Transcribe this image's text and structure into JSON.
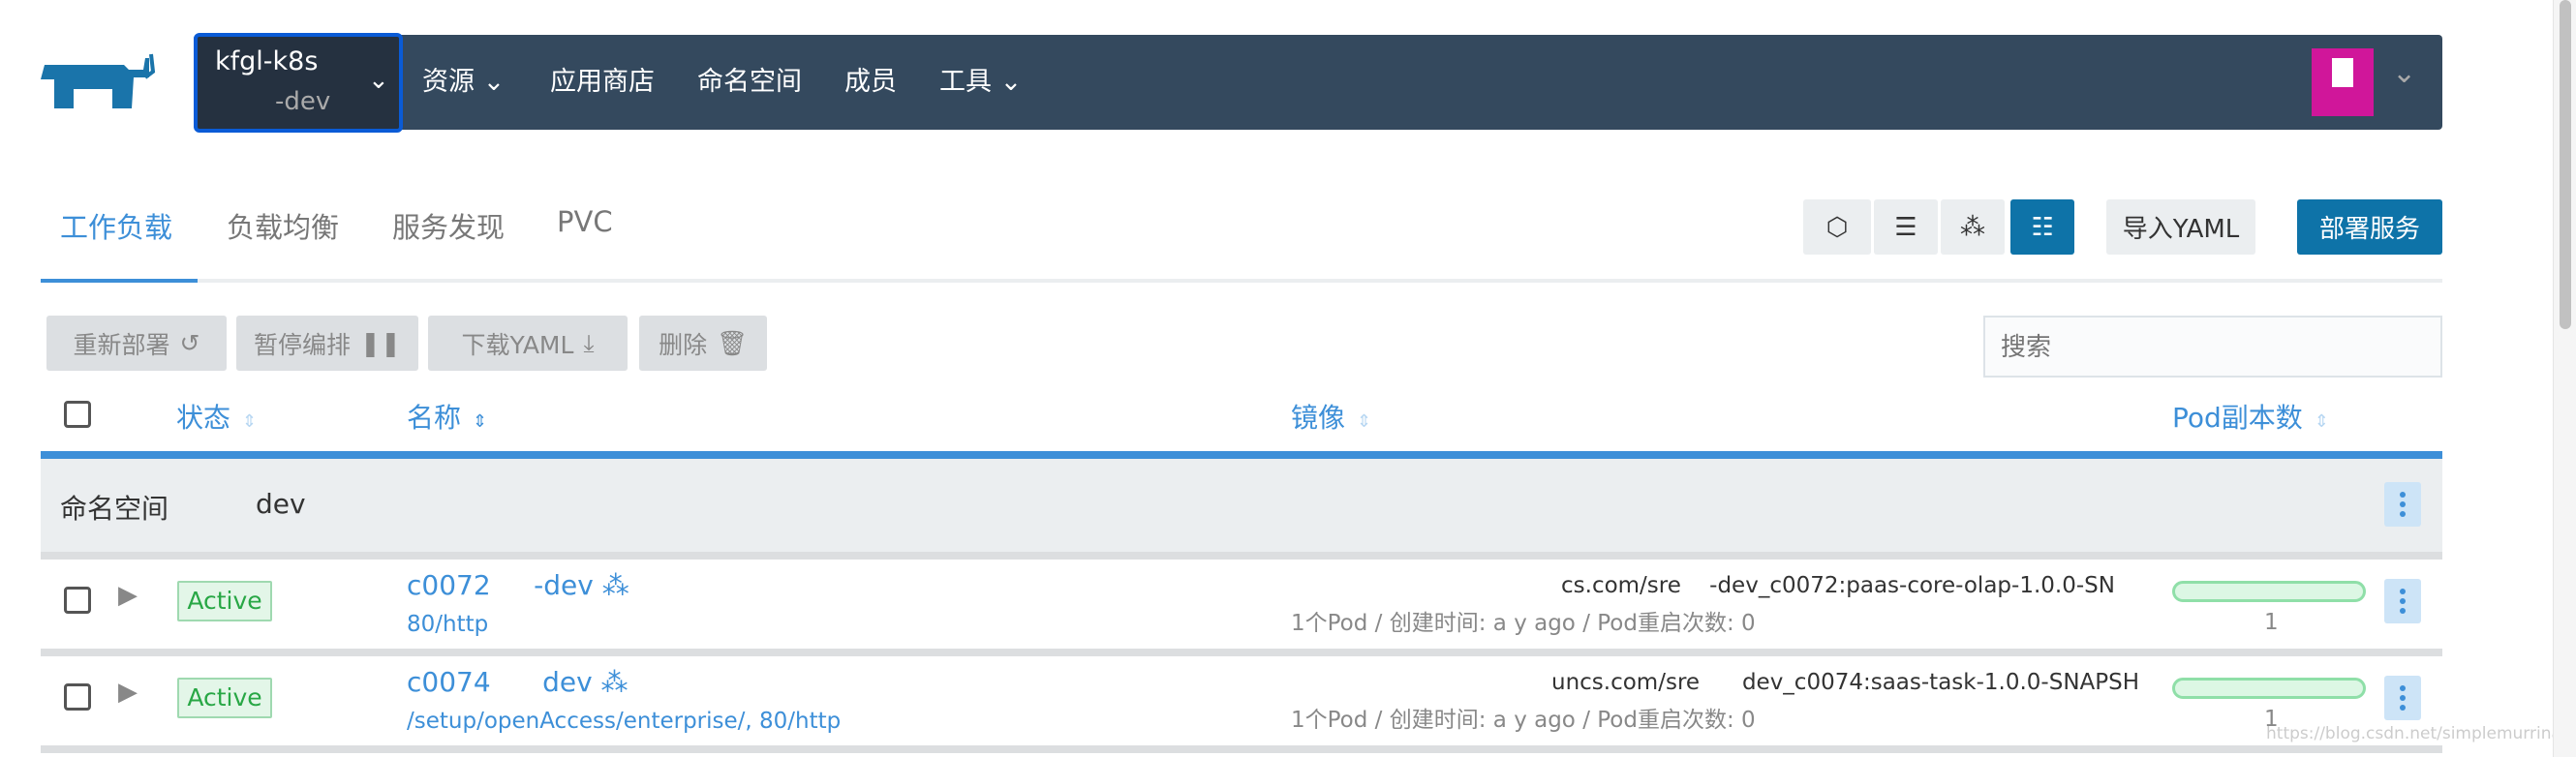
{
  "brand": {
    "logo": "rancher-cow-logo",
    "color": "#1a74aa"
  },
  "cluster": {
    "name": "kfgl-k8s",
    "project": "-dev"
  },
  "nav": {
    "items": [
      "资源",
      "应用商店",
      "命名空间",
      "成员",
      "工具"
    ]
  },
  "tabs": [
    "工作负载",
    "负载均衡",
    "服务发现",
    "PVC"
  ],
  "view_buttons": [
    "cube-icon",
    "server-icon",
    "cubes-icon",
    "list-icon"
  ],
  "import_yaml": "导入YAML",
  "deploy": "部署服务",
  "actions": {
    "redeploy": "重新部署",
    "pause": "暂停编排",
    "download": "下载YAML",
    "delete": "删除"
  },
  "search": {
    "placeholder": "搜索"
  },
  "columns": {
    "state": "状态",
    "name": "名称",
    "image": "镜像",
    "pods": "Pod副本数"
  },
  "group": {
    "label": "命名空间",
    "value": "dev"
  },
  "rows": [
    {
      "state": "Active",
      "name": "c0072",
      "name_suffix": "-dev",
      "endpoint": "80/http",
      "image": "cs.com/sre",
      "image_tail": "-dev_c0072:paas-core-olap-1.0.0-SN",
      "meta": "1个Pod / 创建时间: a y  ago / Pod重启次数: 0",
      "pods": "1",
      "pods_ready_fraction": 1
    },
    {
      "state": "Active",
      "name": "c0074",
      "name_suffix": "dev",
      "endpoint": "/setup/openAccess/enterprise/, 80/http",
      "image": "uncs.com/sre",
      "image_tail": "dev_c0074:saas-task-1.0.0-SNAPSH",
      "meta": "1个Pod / 创建时间: a y  ago / Pod重启次数: 0",
      "pods": "1",
      "pods_ready_fraction": 1
    }
  ],
  "watermark": "https://blog.csdn.net/simplemurrina"
}
